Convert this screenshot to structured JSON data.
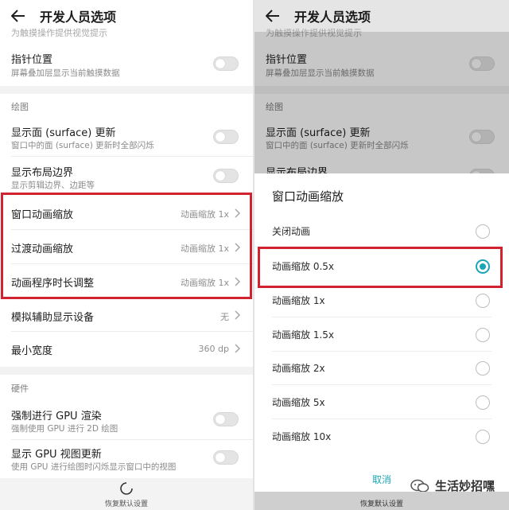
{
  "header": {
    "title": "开发人员选项"
  },
  "left": {
    "cut_text": "为触摸操作提供视觉提示",
    "pointer": {
      "title": "指针位置",
      "subtitle": "屏幕叠加层显示当前触摸数据"
    },
    "section_draw": "绘图",
    "surface": {
      "title": "显示面 (surface) 更新",
      "subtitle": "窗口中的面 (surface) 更新时全部闪烁"
    },
    "layout": {
      "title": "显示布局边界",
      "subtitle": "显示剪辑边界、边距等"
    },
    "window_anim": {
      "title": "窗口动画缩放",
      "value": "动画缩放 1x"
    },
    "transition_anim": {
      "title": "过渡动画缩放",
      "value": "动画缩放 1x"
    },
    "animator_duration": {
      "title": "动画程序时长调整",
      "value": "动画缩放 1x"
    },
    "simulate_display": {
      "title": "模拟辅助显示设备",
      "value": "无"
    },
    "min_width": {
      "title": "最小宽度",
      "value": "360 dp"
    },
    "section_hw": "硬件",
    "force_gpu": {
      "title": "强制进行 GPU 渲染",
      "subtitle": "强制使用 GPU 进行 2D 绘图"
    },
    "gpu_view": {
      "title": "显示 GPU 视图更新",
      "subtitle": "使用 GPU 进行绘图时闪烁显示窗口中的视图"
    },
    "footer": "恢复默认设置"
  },
  "right": {
    "cut_text": "为触摸操作提供视觉提示",
    "pointer": {
      "title": "指针位置",
      "subtitle": "屏幕叠加层显示当前触摸数据"
    },
    "section_draw": "绘图",
    "surface": {
      "title": "显示面 (surface) 更新",
      "subtitle": "窗口中的面 (surface) 更新时全部闪烁"
    },
    "layout": {
      "title": "显示布局边界"
    },
    "dialog": {
      "title": "窗口动画缩放",
      "options": [
        "关闭动画",
        "动画缩放 0.5x",
        "动画缩放 1x",
        "动画缩放 1.5x",
        "动画缩放 2x",
        "动画缩放 5x",
        "动画缩放 10x"
      ],
      "selected": "动画缩放 0.5x",
      "cancel": "取消"
    },
    "footer": "恢复默认设置",
    "watermark": "生活妙招嘿"
  },
  "colors": {
    "highlight": "#d0232f",
    "accent": "#1aa6b7"
  }
}
